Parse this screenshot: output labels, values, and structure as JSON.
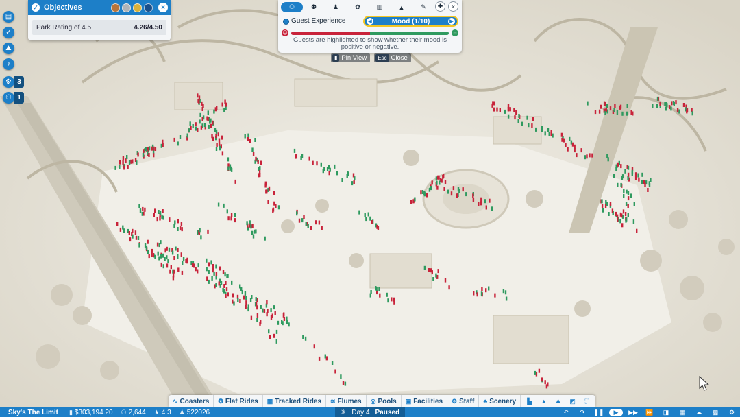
{
  "objectives": {
    "title": "Objectives",
    "rows": [
      {
        "label": "Park Rating of 4.5",
        "value": "4.26/4.50"
      }
    ],
    "medal_colors": [
      "#b8743a",
      "#b0b4b8",
      "#d9b13a",
      "#1a4f8a"
    ]
  },
  "left_rail": {
    "items": [
      {
        "icon": "clipboard-icon",
        "glyph": "▤"
      },
      {
        "icon": "check-circle-icon",
        "glyph": "✓"
      },
      {
        "icon": "landscape-icon",
        "glyph": "⛰"
      },
      {
        "icon": "bell-icon",
        "glyph": "🔔"
      },
      {
        "icon": "gear-icon",
        "glyph": "⚙",
        "count": "3"
      },
      {
        "icon": "people-icon",
        "glyph": "⚇",
        "count": "1"
      }
    ]
  },
  "guest_experience": {
    "label": "Guest Experience",
    "mode": "Mood (1/10)",
    "description": "Guests are highlighted to show whether their mood is positive or negative.",
    "tabs": [
      {
        "icon": "guests-icon",
        "glyph": "⚇"
      },
      {
        "icon": "group-icon",
        "glyph": "⚉"
      },
      {
        "icon": "person-icon",
        "glyph": "♟"
      },
      {
        "icon": "footprints-icon",
        "glyph": "✿"
      },
      {
        "icon": "building-icon",
        "glyph": "▥"
      },
      {
        "icon": "ride-icon",
        "glyph": "▲"
      },
      {
        "icon": "wrench-icon",
        "glyph": "✎"
      }
    ],
    "colors": {
      "negative": "#c8233a",
      "positive": "#2f9a5f"
    }
  },
  "view_controls": {
    "pin_label": "Pin View",
    "close_key": "Esc",
    "close_label": "Close"
  },
  "build_bar": {
    "items": [
      {
        "name": "coasters",
        "label": "Coasters",
        "glyph": "∿"
      },
      {
        "name": "flat-rides",
        "label": "Flat Rides",
        "glyph": "✪"
      },
      {
        "name": "tracked-rides",
        "label": "Tracked Rides",
        "glyph": "▦"
      },
      {
        "name": "flumes",
        "label": "Flumes",
        "glyph": "≋"
      },
      {
        "name": "pools",
        "label": "Pools",
        "glyph": "◎"
      },
      {
        "name": "facilities",
        "label": "Facilities",
        "glyph": "▣"
      },
      {
        "name": "staff",
        "label": "Staff",
        "glyph": "⚙"
      },
      {
        "name": "scenery",
        "label": "Scenery",
        "glyph": "♣"
      }
    ],
    "tool_icons": [
      "terrain-icon",
      "path-icon",
      "landscape-tool-icon",
      "camera-icon",
      "expand-icon"
    ]
  },
  "status_bar": {
    "park_name": "Sky's The Limit",
    "money": "$303,194.20",
    "guests": "2,644",
    "rating": "4.3",
    "research": "522026",
    "day": "Day 4",
    "state": "Paused"
  }
}
